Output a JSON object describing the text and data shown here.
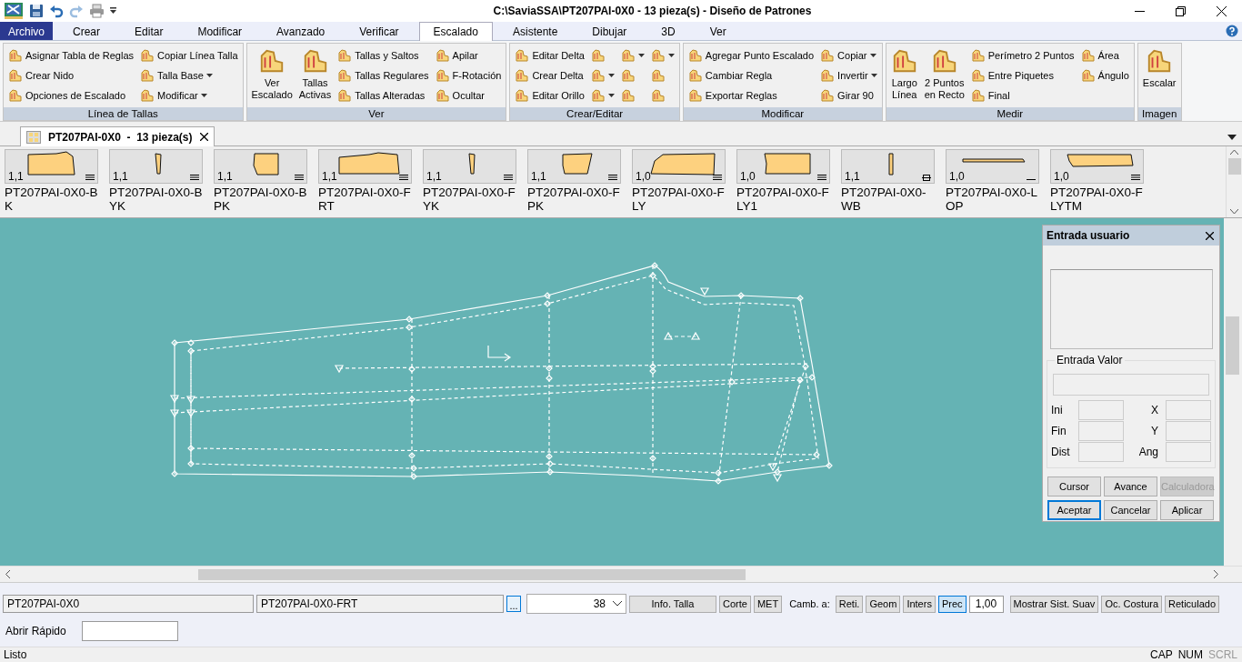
{
  "window": {
    "title": "C:\\SaviaSSA\\PT207PAI-0X0  -  13 pieza(s) - Diseño de Patrones"
  },
  "menu_tabs": [
    {
      "label": "Archivo",
      "kind": "file",
      "selected": false
    },
    {
      "label": "Crear",
      "kind": "tab",
      "selected": false
    },
    {
      "label": "Editar",
      "kind": "tab",
      "selected": false
    },
    {
      "label": "Modificar",
      "kind": "tab",
      "selected": false
    },
    {
      "label": "Avanzado",
      "kind": "tab",
      "selected": false
    },
    {
      "label": "Verificar",
      "kind": "tab",
      "selected": false
    },
    {
      "label": "Escalado",
      "kind": "tab",
      "selected": true
    },
    {
      "label": "Asistente",
      "kind": "tab",
      "selected": false
    },
    {
      "label": "Dibujar",
      "kind": "tab",
      "selected": false
    },
    {
      "label": "3D",
      "kind": "tab",
      "selected": false
    },
    {
      "label": "Ver",
      "kind": "tab",
      "selected": false
    }
  ],
  "ribbon": {
    "groups": [
      {
        "caption": "Línea de Tallas",
        "items": [
          {
            "kind": "column",
            "buttons": [
              {
                "label": "Asignar Tabla de Reglas",
                "dropdown": false
              },
              {
                "label": "Crear Nido",
                "dropdown": false
              },
              {
                "label": "Opciones de Escalado",
                "dropdown": false
              }
            ]
          },
          {
            "kind": "column",
            "buttons": [
              {
                "label": "Copiar Línea Talla",
                "dropdown": false
              },
              {
                "label": "Talla Base",
                "dropdown": true
              },
              {
                "label": "Modificar",
                "dropdown": true
              }
            ]
          }
        ]
      },
      {
        "caption": "Ver",
        "items": [
          {
            "kind": "large",
            "label": "Ver\nEscalado"
          },
          {
            "kind": "large",
            "label": "Tallas\nActivas"
          },
          {
            "kind": "column",
            "buttons": [
              {
                "label": "Tallas y Saltos",
                "dropdown": false
              },
              {
                "label": "Tallas Regulares",
                "dropdown": false
              },
              {
                "label": "Tallas Alteradas",
                "dropdown": false
              }
            ]
          },
          {
            "kind": "column",
            "buttons": [
              {
                "label": "Apilar",
                "dropdown": false
              },
              {
                "label": "F-Rotación",
                "dropdown": false
              },
              {
                "label": "Ocultar",
                "dropdown": false
              }
            ]
          }
        ]
      },
      {
        "caption": "Crear/Editar",
        "items": [
          {
            "kind": "column",
            "buttons": [
              {
                "label": "Editar Delta",
                "dropdown": false
              },
              {
                "label": "Crear Delta",
                "dropdown": false
              },
              {
                "label": "Editar Orillo",
                "dropdown": false
              }
            ]
          },
          {
            "kind": "column",
            "buttons": [
              {
                "dropdown": false
              },
              {
                "dropdown": true
              },
              {
                "dropdown": true
              }
            ]
          },
          {
            "kind": "column",
            "buttons": [
              {
                "dropdown": true
              },
              {
                "dropdown": false
              },
              {
                "dropdown": false
              }
            ]
          },
          {
            "kind": "column",
            "buttons": [
              {
                "dropdown": true
              },
              {
                "dropdown": false
              },
              {
                "dropdown": false
              }
            ]
          }
        ]
      },
      {
        "caption": "Modificar",
        "items": [
          {
            "kind": "column",
            "buttons": [
              {
                "label": "Agregar Punto Escalado",
                "dropdown": false
              },
              {
                "label": "Cambiar Regla",
                "dropdown": false
              },
              {
                "label": "Exportar Reglas",
                "dropdown": false
              }
            ]
          },
          {
            "kind": "column",
            "buttons": [
              {
                "label": "Copiar",
                "dropdown": true
              },
              {
                "label": "Invertir",
                "dropdown": true
              },
              {
                "label": "Girar 90",
                "dropdown": false
              }
            ]
          }
        ]
      },
      {
        "caption": "Medir",
        "items": [
          {
            "kind": "large",
            "label": "Largo\nLínea"
          },
          {
            "kind": "large",
            "label": "2 Puntos\nen Recto"
          },
          {
            "kind": "column",
            "buttons": [
              {
                "label": "Perímetro 2 Puntos",
                "dropdown": false
              },
              {
                "label": "Entre Piquetes",
                "dropdown": false
              },
              {
                "label": "Final",
                "dropdown": false
              }
            ]
          },
          {
            "kind": "column",
            "buttons": [
              {
                "label": "Área",
                "dropdown": false
              },
              {
                "label": "Ángulo",
                "dropdown": false
              }
            ]
          }
        ]
      },
      {
        "caption": "Imagen",
        "items": [
          {
            "kind": "large",
            "label": "Escalar"
          }
        ]
      }
    ]
  },
  "document_tabs": [
    {
      "label": "PT207PAI-0X0  -  13 pieza(s)",
      "selected": true
    }
  ],
  "pieces": [
    {
      "label": "PT207PAI-0X0-BK",
      "scale": "1,1",
      "kind": "body"
    },
    {
      "label": "PT207PAI-0X0-BYK",
      "scale": "1,1",
      "kind": "sliver"
    },
    {
      "label": "PT207PAI-0X0-BPK",
      "scale": "1,1",
      "kind": "block"
    },
    {
      "label": "PT207PAI-0X0-FRT",
      "scale": "1,1",
      "kind": "longbody"
    },
    {
      "label": "PT207PAI-0X0-FYK",
      "scale": "1,1",
      "kind": "sliver"
    },
    {
      "label": "PT207PAI-0X0-FPK",
      "scale": "1,1",
      "kind": "trapezoid"
    },
    {
      "label": "PT207PAI-0X0-FLY",
      "scale": "1,0",
      "kind": "curved"
    },
    {
      "label": "PT207PAI-0X0-FLY1",
      "scale": "1,0",
      "kind": "rect"
    },
    {
      "label": "PT207PAI-0X0-WB",
      "scale": "1,1",
      "kind": "post"
    },
    {
      "label": "PT207PAI-0X0-LOP",
      "scale": "1,0",
      "kind": "strap"
    },
    {
      "label": "PT207PAI-0X0-FLYTM",
      "scale": "1,0",
      "kind": "band"
    }
  ],
  "entry_panel": {
    "title": "Entrada usuario",
    "legend": "Entrada Valor",
    "fields": [
      {
        "label": "Ini"
      },
      {
        "label": "X"
      },
      {
        "label": "Fin"
      },
      {
        "label": "Y"
      },
      {
        "label": "Dist"
      },
      {
        "label": "Ang"
      }
    ],
    "buttons": [
      {
        "label": "Cursor",
        "disabled": false,
        "focused": false
      },
      {
        "label": "Avance",
        "disabled": false,
        "focused": false
      },
      {
        "label": "Calculadora",
        "disabled": true,
        "focused": false
      },
      {
        "label": "Aceptar",
        "disabled": false,
        "focused": true
      },
      {
        "label": "Cancelar",
        "disabled": false,
        "focused": false
      },
      {
        "label": "Aplicar",
        "disabled": false,
        "focused": false
      }
    ]
  },
  "bottom_bar": {
    "model_field": "PT207PAI-0X0",
    "piece_field": "PT207PAI-0X0-FRT",
    "browse_button": "...",
    "size_select": "38",
    "buttons_left": [
      "Info. Talla",
      "Corte",
      "MET"
    ],
    "change_label": "Camb. a:",
    "toggles": [
      {
        "label": "Reti.",
        "selected": false
      },
      {
        "label": "Geom",
        "selected": false
      },
      {
        "label": "Inters",
        "selected": false
      },
      {
        "label": "Prec",
        "selected": true
      }
    ],
    "value_field": "1,00",
    "buttons_right": [
      "Mostrar Sist. Suav",
      "Oc. Costura",
      "Reticulado"
    ],
    "quick_open_label": "Abrir Rápido"
  },
  "status_bar": {
    "text": "Listo",
    "indicators": [
      {
        "label": "CAP",
        "on": true
      },
      {
        "label": "NUM",
        "on": true
      },
      {
        "label": "SCRL",
        "on": false
      }
    ]
  }
}
